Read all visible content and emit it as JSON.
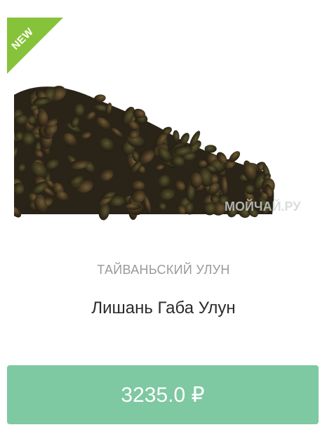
{
  "badge": {
    "label": "NEW",
    "color": "#86c33a"
  },
  "product": {
    "category": "ТАЙВАНЬСКИЙ УЛУН",
    "name": "Лишань Габа Улун",
    "price": "3235.0 ₽",
    "image_watermark": "МОЙЧАЙ.РУ"
  },
  "button_color": "#7ec8a2"
}
